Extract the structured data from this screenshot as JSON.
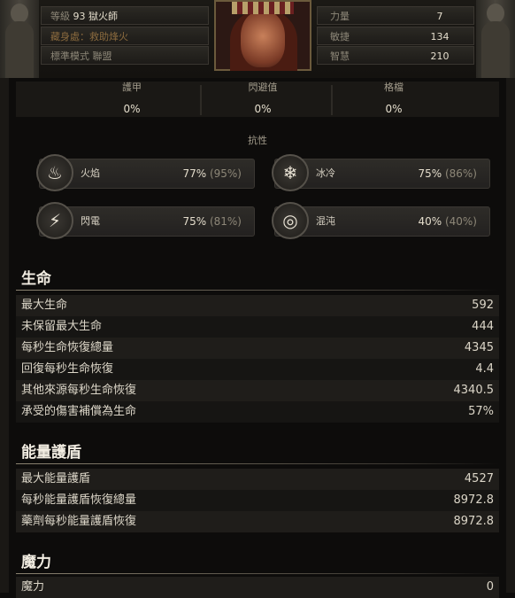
{
  "header": {
    "level_label": "等級",
    "level": "93",
    "class_name": "獄火師",
    "hideout_label": "藏身處：",
    "hideout_value": "救助烽火",
    "league_label": "標準模式",
    "league_value": "聯盟",
    "attributes": [
      {
        "label": "力量",
        "value": "7"
      },
      {
        "label": "敏捷",
        "value": "134"
      },
      {
        "label": "智慧",
        "value": "210"
      }
    ]
  },
  "defences": [
    {
      "label": "護甲",
      "value": "0%"
    },
    {
      "label": "閃避值",
      "value": "0%"
    },
    {
      "label": "格檔",
      "value": "0%"
    }
  ],
  "resistances": {
    "title": "抗性",
    "items": [
      {
        "name": "火焰",
        "value": "77%",
        "max": "(95%)",
        "icon": "fire-icon"
      },
      {
        "name": "冰冷",
        "value": "75%",
        "max": "(86%)",
        "icon": "snowflake-icon"
      },
      {
        "name": "閃電",
        "value": "75%",
        "max": "(81%)",
        "icon": "lightning-icon"
      },
      {
        "name": "混沌",
        "value": "40%",
        "max": "(40%)",
        "icon": "chaos-spiral-icon"
      }
    ]
  },
  "sections": {
    "life": {
      "title": "生命",
      "rows": [
        {
          "label": "最大生命",
          "value": "592"
        },
        {
          "label": "未保留最大生命",
          "value": "444"
        },
        {
          "label": "每秒生命恢復總量",
          "value": "4345"
        },
        {
          "label": "回復每秒生命恢復",
          "value": "4.4"
        },
        {
          "label": "其他來源每秒生命恢復",
          "value": "4340.5"
        },
        {
          "label": "承受的傷害補償為生命",
          "value": "57%"
        }
      ]
    },
    "energy_shield": {
      "title": "能量護盾",
      "rows": [
        {
          "label": "最大能量護盾",
          "value": "4527"
        },
        {
          "label": "每秒能量護盾恢復總量",
          "value": "8972.8"
        },
        {
          "label": "藥劑每秒能量護盾恢復",
          "value": "8972.8"
        }
      ]
    },
    "mana": {
      "title": "魔力",
      "rows": [
        {
          "label": "魔力",
          "value": "0"
        }
      ]
    }
  }
}
